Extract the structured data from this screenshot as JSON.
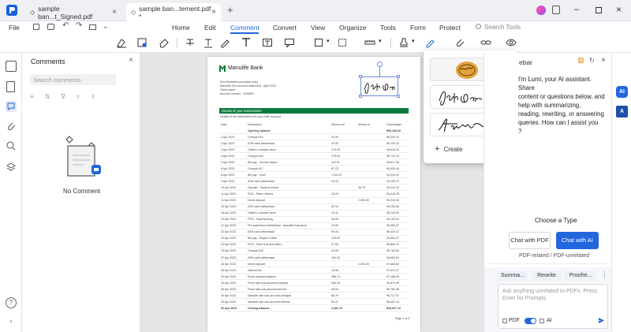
{
  "tabs": [
    {
      "label": "sample ban...t_Signed.pdf"
    },
    {
      "label": "sample ban...tement.pdf *"
    }
  ],
  "menu": {
    "file": "File",
    "home": "Home",
    "edit": "Edit",
    "comment": "Comment",
    "convert": "Convert",
    "view": "View",
    "organize": "Organize",
    "tools": "Tools",
    "form": "Form",
    "protect": "Protect",
    "search_tools": "Search Tools"
  },
  "comments": {
    "title": "Comments",
    "search_placeholder": "Search comments",
    "empty": "No Comment"
  },
  "signatures": {
    "create": "Create"
  },
  "doc": {
    "bank": "Manulife Bank",
    "addr": [
      "(For illustrative purposes only)",
      "Manulife One account statement - April 2023",
      "Client name",
      "Account number : 123456T"
    ],
    "section": "Details of your transactions",
    "subsection": "Details of the transactions for your main account",
    "cols": [
      "Date",
      "Description",
      "Money out",
      "Money in",
      "Overmargin"
    ],
    "rows": [
      [
        "",
        "Opening balance",
        "",
        "",
        "$96,245.42"
      ],
      [
        "1 Apr 2023",
        "Cheque #15",
        "24.90",
        "",
        "96,230.32"
      ],
      [
        "3 Apr 2023",
        "ATM cash withdrawal",
        "40.00",
        "",
        "96,190.32"
      ],
      [
        "3 Apr 2023",
        "Online e-transfer send",
        "175.00",
        "",
        "96,015.32"
      ],
      [
        "4 Apr 2023",
        "Cheque #16",
        "175.83",
        "",
        "95,731.19"
      ],
      [
        "5 Apr 2023",
        "Bill pay - Toronto Hydro",
        "113.91",
        "",
        "95,617.28"
      ],
      [
        "6 Apr 2023",
        "Cheque #17",
        "87.23",
        "",
        "95,530.44"
      ],
      [
        "8 Apr 2023",
        "Bill pay - Visa*",
        "1,315.97",
        "",
        "94,215.47"
      ],
      [
        "9 Apr 2023",
        "ATM cash withdrawal",
        "20.00",
        "",
        "94,195.47"
      ],
      [
        "10 Apr 2023",
        "Deposit - Student refund",
        "",
        "38.75",
        "94,234.22"
      ],
      [
        "11 Apr 2023",
        "POS - Petro refiners",
        "18.29",
        "",
        "94,215.93"
      ],
      [
        "11 Apr 2023",
        "Direct deposit",
        "",
        "2,000.00",
        "96,215.93"
      ],
      [
        "15 Apr 2023",
        "ATM cash withdrawal",
        "60.00",
        "",
        "96,155.93"
      ],
      [
        "18 Apr 2023",
        "Online e-transfer send",
        "12.41",
        "",
        "96,143.52"
      ],
      [
        "20 Apr 2023",
        "POS - Gas/Sporting",
        "34.50",
        "",
        "96,109.02"
      ],
      [
        "21 Apr 2023",
        "Pre-authorized withdrawal - Manulife Insurance",
        "19.95",
        "",
        "96,089.07"
      ],
      [
        "22 Apr 2023",
        "ATM cash withdrawal",
        "60.00",
        "",
        "96,029.07"
      ],
      [
        "23 Apr 2023",
        "Bill pay - Rogers Cable",
        "125.00",
        "",
        "95,904.07"
      ],
      [
        "24 Apr 2023",
        "POS - Shell Gas and Bistro",
        "97.60",
        "",
        "95,806.47"
      ],
      [
        "25 Apr 2023",
        "Cheque #18",
        "42.85",
        "",
        "95,763.62"
      ],
      [
        "27 Apr 2023",
        "ATM cash withdrawal",
        "100.00",
        "",
        "95,663.62"
      ],
      [
        "28 Apr 2023",
        "Direct deposit",
        "",
        "2,000.00",
        "97,663.62"
      ],
      [
        "28 Apr 2023",
        "Interest fee",
        "15.95",
        "",
        "97,647.67"
      ],
      [
        "30 Apr 2023",
        "Fixed account balance",
        "458.74",
        "",
        "97,188.93"
      ],
      [
        "30 Apr 2023",
        "Fixed rate sub-account principal",
        "309.03",
        "",
        "96,879.90"
      ],
      [
        "30 Apr 2023",
        "Fixed rate sub-account interest",
        "95.54",
        "",
        "96,784.36"
      ],
      [
        "30 Apr 2023",
        "Variable rate sub-account principal",
        "66.79",
        "",
        "96,717.57"
      ],
      [
        "30 Apr 2023",
        "Variable rate sub-account interest",
        "50.47",
        "",
        "96,667.10"
      ],
      [
        "30 Apr 2023",
        "Closing balance",
        "2,081.75",
        "",
        "$96,667.10"
      ]
    ],
    "pagenum": "Page 1 of 3"
  },
  "ai": {
    "header": "ebar",
    "intro": "I'm Lumi, your AI assistant. Share content or questions below, and help with summarizing, reading, rewriting, or answering queries. How can I assist you?",
    "intro_lines": [
      "I'm Lumi, your AI assistant. Share",
      "content or questions below, and",
      "help with summarizing,",
      "reading, rewriting, or answering",
      "queries. How can I assist you",
      "?"
    ],
    "choose": "Choose a Type",
    "chat_pdf": "Chat with PDF",
    "chat_ai": "Chat with AI",
    "related": "PDF-related / PDF-unrelated",
    "summarize": "Summa...",
    "rewrite": "Rewrite",
    "proofread": "Proofre...",
    "input_placeholder": "Ask anything unrelated to PDFs. Press Enter for Prompts.",
    "pdf_label": "PDF",
    "ai_label": "AI"
  },
  "colors": {
    "accent": "#2266dd",
    "bank_green": "#0a7a3c"
  }
}
